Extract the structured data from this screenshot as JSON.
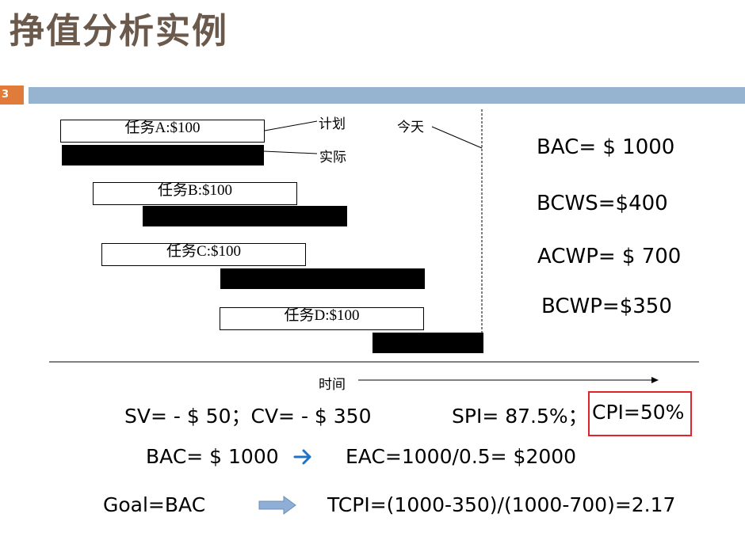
{
  "slide": {
    "title": "挣值分析实例",
    "number": "3"
  },
  "gantt": {
    "tasks": [
      {
        "label": "任务A:$100"
      },
      {
        "label": "任务B:$100"
      },
      {
        "label": "任务C:$100"
      },
      {
        "label": "任务D:$100"
      }
    ],
    "legend": {
      "plan": "计划",
      "actual": "实际"
    },
    "today_label": "今天",
    "time_label": "时间"
  },
  "metrics": {
    "bac": "BAC= $ 1000",
    "bcws": "BCWS=$400",
    "acwp": "ACWP= $ 700",
    "bcwp": "BCWP=$350"
  },
  "formulas": {
    "sv_cv": "SV= - $ 50；CV= - $ 350",
    "spi": "SPI= 87.5%；",
    "cpi": "CPI=50%",
    "bac": "BAC= $ 1000",
    "eac": "EAC=1000/0.5= $2000",
    "goal": "Goal=BAC",
    "tcpi": "TCPI=(1000-350)/(1000-700)=2.17"
  },
  "colors": {
    "title": "#6b5a4c",
    "header_bar": "#96b4cf",
    "slide_number_bg": "#e07b39",
    "highlight_box": "#e0242b",
    "arrow_blue": "#1f73c4",
    "block_arrow": "#8eaed6"
  },
  "icons": {
    "small_arrow": "right-arrow-icon",
    "block_arrow": "block-arrow-icon"
  }
}
